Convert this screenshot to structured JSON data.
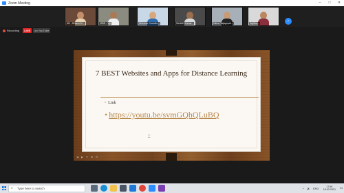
{
  "window": {
    "title": "Zoom Meeting",
    "controls": [
      "–",
      "□",
      "✕"
    ]
  },
  "participants": [
    {
      "name": "KD - Bhanu M...",
      "bg": "#6b4a3a",
      "skin": "#c48e6a",
      "shirt": "#e6d2b0"
    },
    {
      "name": "VIBS - Viji",
      "bg": "#8b8b80",
      "skin": "#a97a55",
      "shirt": "#f0f0f0"
    },
    {
      "name": "Webinar Coordin...",
      "bg": "#c8d8e6",
      "skin": "#d7a77d",
      "shirt": "#2e6db0"
    },
    {
      "name": "Senthil Kumar...",
      "bg": "#4a4a4a",
      "skin": "#9b6e4e",
      "shirt": "#d9d9d9"
    },
    {
      "name": "Nitha Rajagopal...",
      "bg": "#a7b0b8",
      "skin": "#c79a78",
      "shirt": "#222222"
    },
    {
      "name": "Sujitha...",
      "bg": "#d9d9d9",
      "skin": "#b98760",
      "shirt": "#8a2f3c"
    }
  ],
  "status": {
    "recording": "Recording",
    "live": "LIVE",
    "platform": "on YouTube"
  },
  "slide": {
    "title": "7 BEST Websites and Apps for Distance Learning",
    "bullet_label": "Link",
    "link": "https://youtu.be/svmGQhQLuBQ"
  },
  "slide_toolbar": [
    "◀",
    "▶",
    "✎",
    "⊞",
    "⊡",
    "⋯"
  ],
  "taskbar": {
    "search_placeholder": "Type here to search",
    "apps": [
      {
        "name": "task-view",
        "color": "#5b6b7b"
      },
      {
        "name": "edge",
        "color": "#1b8fd6"
      },
      {
        "name": "file-explorer",
        "color": "#f2c14e"
      },
      {
        "name": "store",
        "color": "#4b5563"
      },
      {
        "name": "mail",
        "color": "#1e78d7"
      },
      {
        "name": "chrome",
        "color": "#e0443a"
      },
      {
        "name": "zoom",
        "color": "#2d8cff"
      },
      {
        "name": "media",
        "color": "#7a3fb0"
      }
    ],
    "tray": [
      "^",
      "🔊",
      "ENG"
    ],
    "time": "17:59",
    "date": "18-03-2021"
  }
}
